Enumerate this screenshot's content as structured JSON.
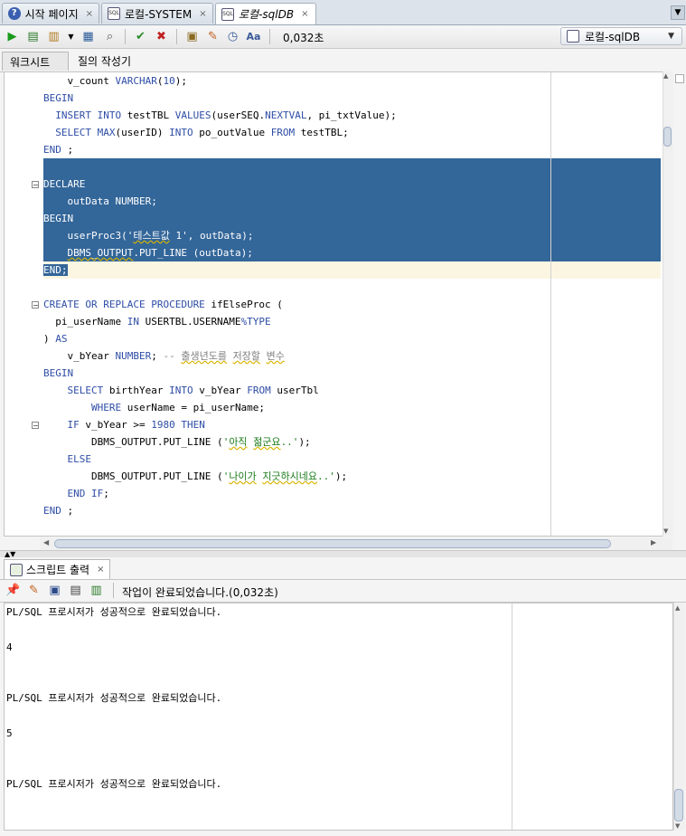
{
  "tabs": [
    {
      "label": "시작 페이지",
      "icon": "help-icon",
      "active": false
    },
    {
      "label": "로컬-SYSTEM",
      "icon": "sql-worksheet-icon",
      "active": false
    },
    {
      "label": "로컬-sqlDB",
      "icon": "sql-worksheet-icon",
      "active": true
    }
  ],
  "tab_close": "×",
  "toolbar": {
    "timing": "0,032초",
    "connection": "로컬-sqlDB"
  },
  "worksheet_tabs": [
    "워크시트",
    "질의 작성기"
  ],
  "editor": {
    "lines": [
      {
        "text": "    v_count VARCHAR(10);"
      },
      {
        "text": "BEGIN"
      },
      {
        "text": "  INSERT INTO testTBL VALUES(userSEQ.NEXTVAL, pi_txtValue);"
      },
      {
        "text": "  SELECT MAX(userID) INTO po_outValue FROM testTBL;"
      },
      {
        "text": "END ;"
      },
      {
        "text": ""
      },
      {
        "text": "DECLARE"
      },
      {
        "text": "    outData NUMBER;"
      },
      {
        "text": "BEGIN"
      },
      {
        "text": "    userProc3('테스트값 1', outData);"
      },
      {
        "text": "    DBMS_OUTPUT.PUT_LINE (outData);"
      },
      {
        "text": "END;"
      },
      {
        "text": ""
      },
      {
        "text": "CREATE OR REPLACE PROCEDURE ifElseProc ("
      },
      {
        "text": "  pi_userName IN USERTBL.USERNAME%TYPE"
      },
      {
        "text": ") AS"
      },
      {
        "text": "    v_bYear NUMBER; -- 출생년도를 저장할 변수"
      },
      {
        "text": "BEGIN"
      },
      {
        "text": "    SELECT birthYear INTO v_bYear FROM userTbl"
      },
      {
        "text": "        WHERE userName = pi_userName;"
      },
      {
        "text": "    IF v_bYear >= 1980 THEN"
      },
      {
        "text": "        DBMS_OUTPUT.PUT_LINE ('아직 젊군요..');"
      },
      {
        "text": "    ELSE"
      },
      {
        "text": "        DBMS_OUTPUT.PUT_LINE ('나이가 지긋하시네요..');"
      },
      {
        "text": "    END IF;"
      },
      {
        "text": "END ;"
      }
    ]
  },
  "output_panel": {
    "tab_label": "스크립트 출력",
    "tab_close": "×",
    "status": "작업이 완료되었습니다.(0,032초)",
    "lines": [
      "PL/SQL 프로시저가 성공적으로 완료되었습니다.",
      "",
      "4",
      "",
      "",
      "PL/SQL 프로시저가 성공적으로 완료되었습니다.",
      "",
      "5",
      "",
      "",
      "PL/SQL 프로시저가 성공적으로 완료되었습니다."
    ]
  },
  "colors": {
    "selection": "#336699",
    "keyword": "#2e4da6",
    "string": "#1a7a1a",
    "comment": "#7f7f7f",
    "current_line": "#fbf6e2"
  }
}
